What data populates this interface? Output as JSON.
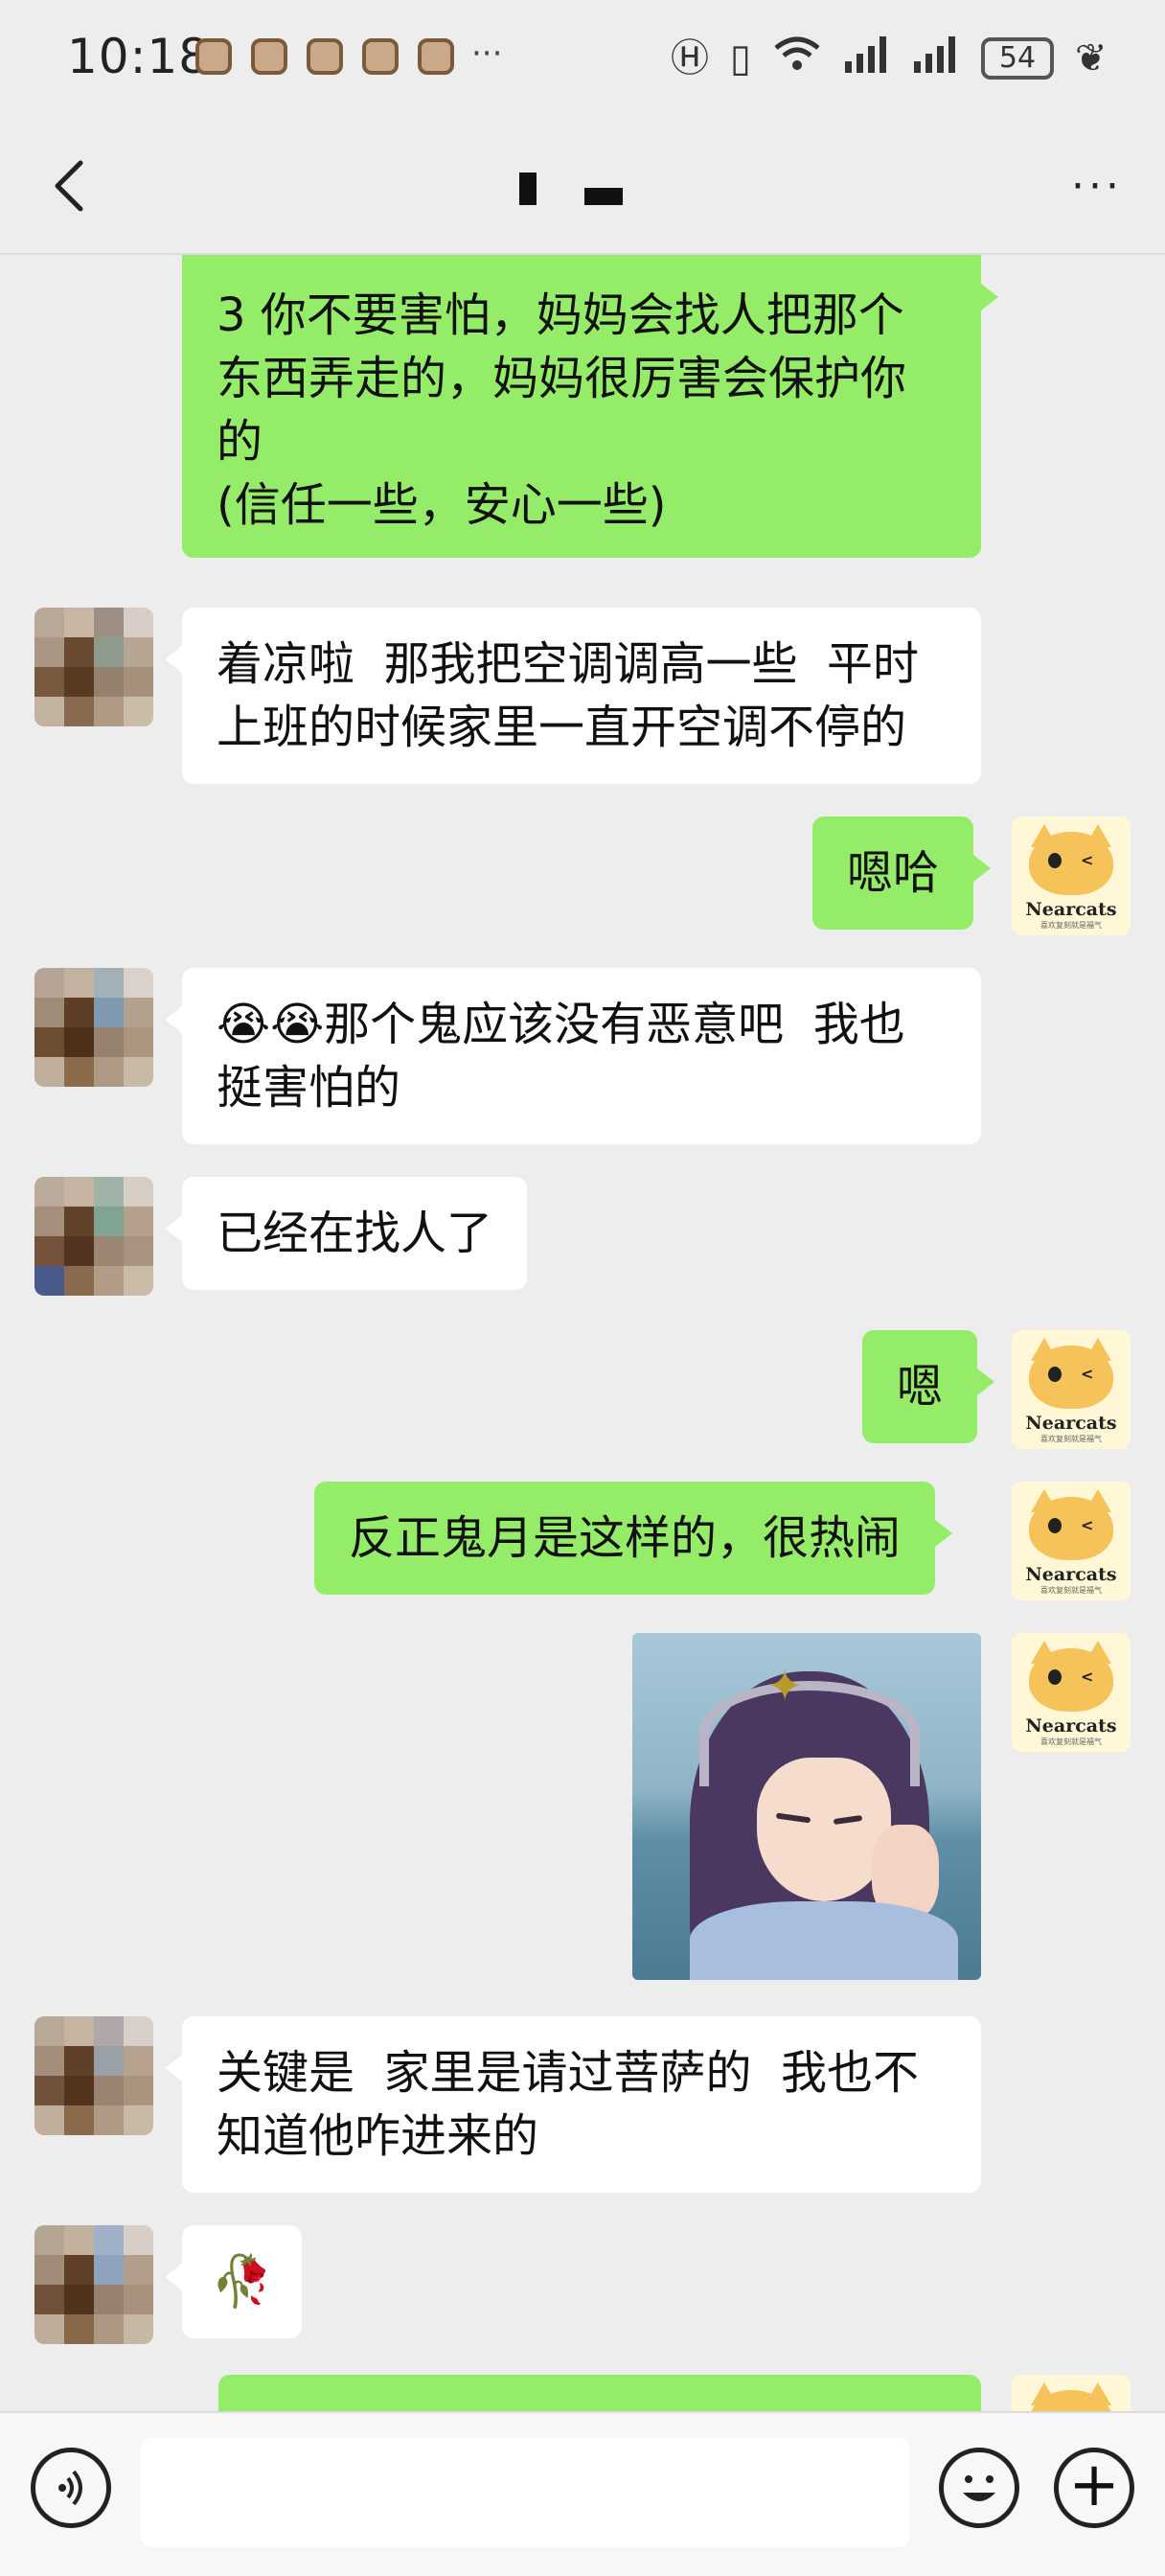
{
  "status_bar": {
    "time": "10:18",
    "more": "···",
    "battery": "54",
    "icons": [
      "hd-icon",
      "vibrate-icon",
      "wifi-icon",
      "signal-icon",
      "signal-icon",
      "battery-icon",
      "leaf-icon"
    ]
  },
  "nav": {
    "back_icon": "chevron-left-icon",
    "more_icon": "ellipsis-icon",
    "more_label": "···"
  },
  "messages": [
    {
      "side": "out",
      "text": "3 你不要害怕，妈妈会找人把那个\n东西弄走的，妈妈很厉害会保护你\n的\n(信任一些，安心一些)"
    },
    {
      "side": "in",
      "text": "着凉啦  那我把空调调高一些  平时\n上班的时候家里一直开空调不停的"
    },
    {
      "side": "out",
      "text": "嗯哈"
    },
    {
      "side": "in",
      "text": "😭😭那个鬼应该没有恶意吧  我也\n挺害怕的"
    },
    {
      "side": "in",
      "text": "已经在找人了"
    },
    {
      "side": "out",
      "text": "嗯"
    },
    {
      "side": "out",
      "text": "反正鬼月是这样的，很热闹"
    },
    {
      "side": "out",
      "type": "image",
      "image_desc": "anime-girl-sticker"
    },
    {
      "side": "in",
      "text": "关键是  家里是请过菩萨的  我也不\n知道他咋进来的"
    },
    {
      "side": "in",
      "text": "🥀"
    }
  ],
  "cat_avatar": {
    "brand": "Nearcats",
    "sub": "喜欢复刻就是福气"
  },
  "bottom_bar": {
    "voice_icon": "voice-icon",
    "emoji_icon": "emoji-icon",
    "plus_icon": "plus-icon",
    "plus_label": "+"
  }
}
